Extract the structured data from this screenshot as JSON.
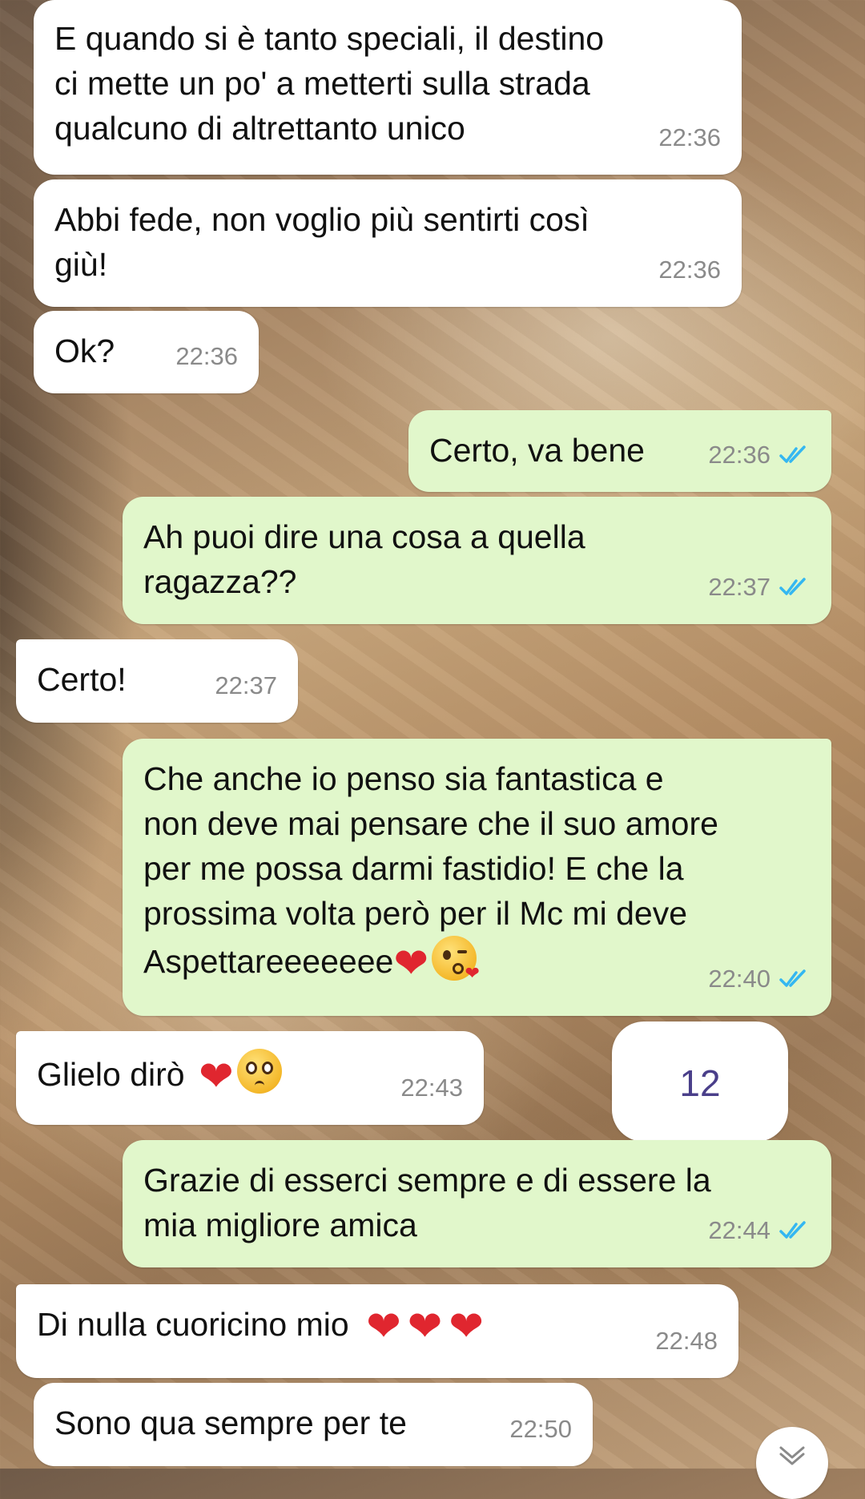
{
  "messages": [
    {
      "direction": "incoming",
      "text_lines": [
        "E quando si è tanto speciali, il destino",
        "ci mette un po' a metterti sulla strada",
        "qualcuno di altrettanto unico"
      ],
      "time": "22:36"
    },
    {
      "direction": "incoming",
      "text_lines": [
        "Abbi fede, non voglio più sentirti così",
        "giù!"
      ],
      "time": "22:36"
    },
    {
      "direction": "incoming",
      "text": "Ok?",
      "time": "22:36"
    },
    {
      "direction": "outgoing",
      "text": "Certo, va bene",
      "time": "22:36",
      "status": "read"
    },
    {
      "direction": "outgoing",
      "text_lines": [
        "Ah puoi dire una cosa a quella",
        "ragazza??"
      ],
      "time": "22:37",
      "status": "read"
    },
    {
      "direction": "incoming",
      "text": "Certo!",
      "time": "22:37"
    },
    {
      "direction": "outgoing",
      "text_lines": [
        "Che anche io penso sia fantastica e",
        "non deve mai pensare che il suo amore",
        "per me possa darmi fastidio! E che la",
        "prossima volta però per il Mc mi deve",
        "Aspettareeeeeee"
      ],
      "emojis": [
        "red-heart",
        "face-blowing-kiss"
      ],
      "time": "22:40",
      "status": "read"
    },
    {
      "direction": "incoming",
      "text": "Glielo dirò",
      "emojis": [
        "red-heart",
        "pleading-face"
      ],
      "time": "22:43"
    },
    {
      "direction": "outgoing",
      "text_lines": [
        "Grazie di esserci sempre e di essere la",
        "mia migliore amica"
      ],
      "time": "22:44",
      "status": "read"
    },
    {
      "direction": "incoming",
      "text": "Di nulla cuoricino mio",
      "emojis": [
        "red-heart",
        "red-heart",
        "red-heart"
      ],
      "time": "22:48"
    },
    {
      "direction": "incoming",
      "text": "Sono qua sempre per te",
      "time": "22:50"
    }
  ],
  "unread_counter": "12",
  "colors": {
    "incoming_bubble": "#ffffff",
    "outgoing_bubble": "#e1f7cb",
    "read_ticks": "#34b7f1",
    "counter_text": "#4a3f8a"
  },
  "icons": {
    "read_receipt": "double-check-icon",
    "scroll_down": "chevron-down-icon",
    "heart": "red-heart-emoji"
  }
}
